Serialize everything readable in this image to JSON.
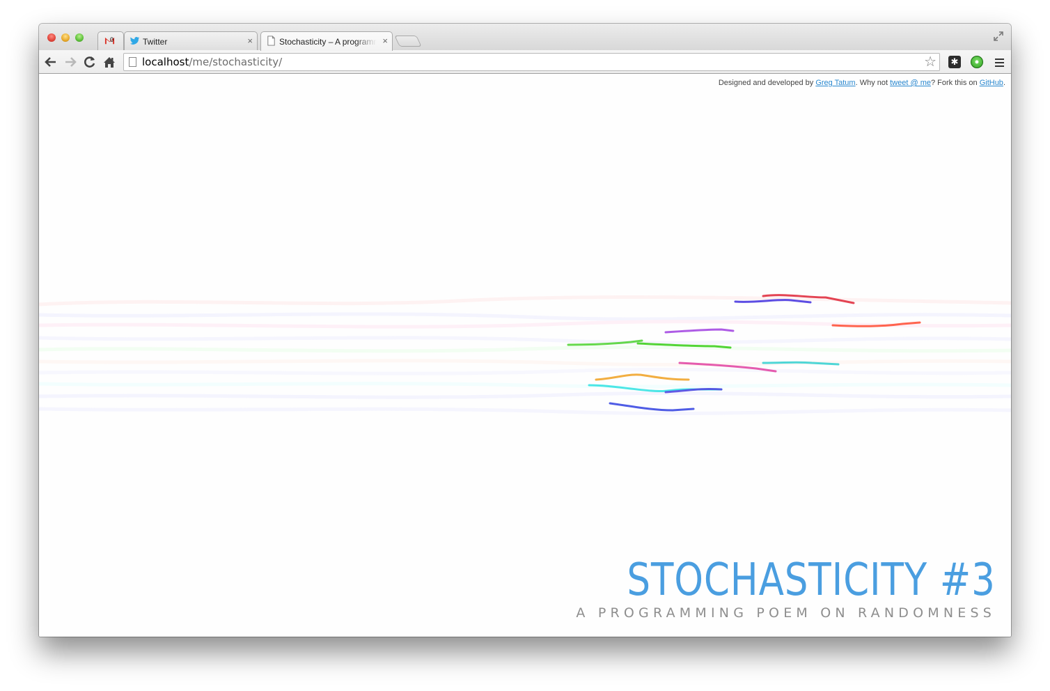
{
  "browser": {
    "tabs": [
      {
        "label": "",
        "icon": "gmail-icon",
        "badge": "0"
      },
      {
        "label": "Twitter",
        "icon": "twitter-icon",
        "close": "×"
      },
      {
        "label": "Stochasticity – A programming poem on randomness",
        "icon": "page-icon",
        "close": "×",
        "active": true
      }
    ],
    "url": {
      "host": "localhost",
      "path": "/me/stochasticity/"
    }
  },
  "page": {
    "credit": {
      "prefix": "Designed and developed by ",
      "author_link": "Greg Tatum",
      "mid": ". Why not ",
      "tweet_link": "tweet @ me",
      "mid2": "? Fork this on ",
      "github_link": "GitHub",
      "suffix": "."
    },
    "title": "STOCHASTICITY #3",
    "subtitle": "A PROGRAMMING POEM ON RANDOMNESS",
    "accent_color": "#4a9ee0",
    "subtitle_color": "#8e8e8e",
    "trail_colors": [
      "#e03040",
      "#4a3ae0",
      "#ff4a30",
      "#a040e0",
      "#40d020",
      "#30d0d0",
      "#e040a0",
      "#f0a020",
      "#3040e0",
      "#20e0e0"
    ]
  }
}
